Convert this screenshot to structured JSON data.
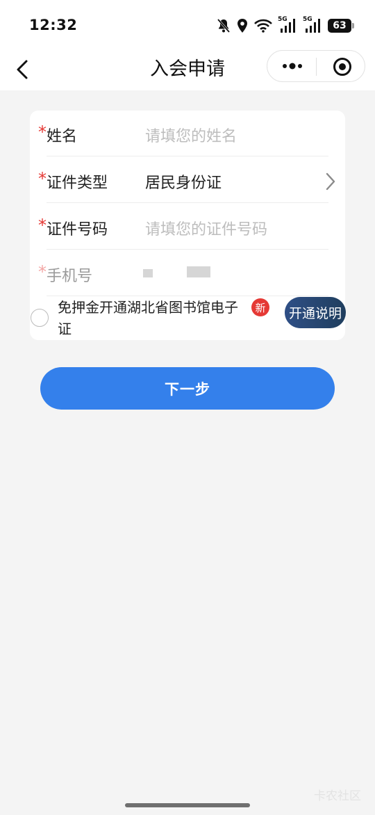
{
  "status_bar": {
    "time": "12:32",
    "signal1_label": "5G",
    "signal2_label": "5G",
    "battery": "63",
    "icons": [
      "bell-off-icon",
      "location-icon",
      "wifi-icon",
      "signal-icon",
      "signal-icon",
      "battery-icon"
    ]
  },
  "nav": {
    "title": "入会申请",
    "back_icon": "chevron-left-icon",
    "more_icon": "more-dots-icon",
    "close_icon": "target-circle-icon"
  },
  "form": {
    "fields": [
      {
        "required_mark": "*",
        "label": "姓名",
        "placeholder": "请填您的姓名"
      },
      {
        "required_mark": "*",
        "label": "证件类型",
        "value": "居民身份证"
      },
      {
        "required_mark": "*",
        "label": "证件号码",
        "placeholder": "请填您的证件号码"
      },
      {
        "required_mark": "*",
        "label": "手机号"
      }
    ],
    "agreement_text": "免押金开通湖北省图书馆电子证",
    "new_badge": "新",
    "explain_button": "开通说明"
  },
  "next_button": "下一步",
  "watermark": "卡农社区",
  "colors": {
    "primary": "#3480eb",
    "required": "#e53935",
    "badge": "#e53935",
    "explain_button": "#2f4f86"
  }
}
